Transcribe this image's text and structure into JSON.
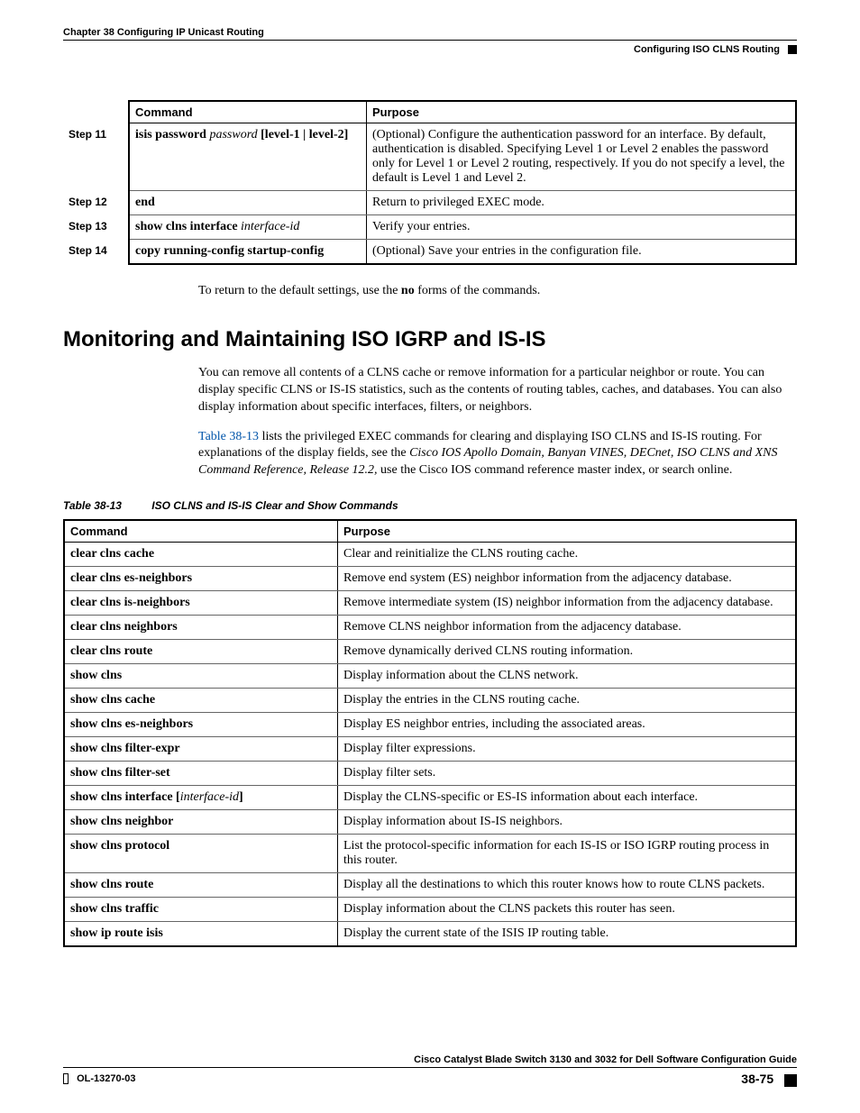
{
  "header": {
    "chapter": "Chapter 38      Configuring IP Unicast Routing",
    "section": "Configuring ISO CLNS Routing"
  },
  "steps_table": {
    "headers": {
      "command": "Command",
      "purpose": "Purpose"
    },
    "rows": [
      {
        "step": "Step 11",
        "cmd_html": "<b>isis password</b> <span class='arg'>password</span> <b>[level-1 | level-2]</b>",
        "purpose": "(Optional) Configure the authentication password for an interface. By default, authentication is disabled. Specifying Level 1 or Level 2 enables the password only for Level 1 or Level 2 routing, respectively. If you do not specify a level, the default is Level 1 and Level 2."
      },
      {
        "step": "Step 12",
        "cmd_html": "<b>end</b>",
        "purpose": "Return to privileged EXEC mode."
      },
      {
        "step": "Step 13",
        "cmd_html": "<b>show clns interface</b> <span class='arg'>interface-id</span>",
        "purpose": "Verify your entries."
      },
      {
        "step": "Step 14",
        "cmd_html": "<b>copy running-config startup-config</b>",
        "purpose": "(Optional) Save your entries in the configuration file."
      }
    ]
  },
  "return_text": "To return to the default settings, use the no forms of the commands.",
  "return_text_bold": "no",
  "heading": "Monitoring and Maintaining ISO IGRP and IS-IS",
  "para1": "You can remove all contents of a CLNS cache or remove information for a particular neighbor or route. You can display specific CLNS or IS-IS statistics, such as the contents of routing tables, caches, and databases. You can also display information about specific interfaces, filters, or neighbors.",
  "para2_link": "Table 38-13",
  "para2_a": " lists the privileged EXEC commands for clearing and displaying ISO CLNS and IS-IS routing. For explanations of the display fields, see the ",
  "para2_italic": "Cisco IOS Apollo Domain, Banyan VINES, DECnet, ISO CLNS and XNS Command Reference, Release 12.2,",
  "para2_b": " use the Cisco IOS command reference master index, or search online.",
  "table_caption_num": "Table 38-13",
  "table_caption_text": "ISO CLNS and IS-IS Clear and Show Commands",
  "cmds_table": {
    "headers": {
      "command": "Command",
      "purpose": "Purpose"
    },
    "rows": [
      {
        "cmd_html": "clear clns cache",
        "purpose": "Clear and reinitialize the CLNS routing cache."
      },
      {
        "cmd_html": "clear clns es-neighbors",
        "purpose": "Remove end system (ES) neighbor information from the adjacency database."
      },
      {
        "cmd_html": "clear clns is-neighbors",
        "purpose": "Remove intermediate system (IS) neighbor information from the adjacency database."
      },
      {
        "cmd_html": "clear clns neighbors",
        "purpose": "Remove CLNS neighbor information from the adjacency database."
      },
      {
        "cmd_html": "clear clns route",
        "purpose": "Remove dynamically derived CLNS routing information."
      },
      {
        "cmd_html": "show clns",
        "purpose": "Display information about the CLNS network."
      },
      {
        "cmd_html": "show clns cache",
        "purpose": "Display the entries in the CLNS routing cache."
      },
      {
        "cmd_html": "show clns es-neighbors",
        "purpose": "Display ES neighbor entries, including the associated areas."
      },
      {
        "cmd_html": "show clns filter-expr",
        "purpose": "Display filter expressions."
      },
      {
        "cmd_html": "show clns filter-set",
        "purpose": "Display filter sets."
      },
      {
        "cmd_html": "show clns interface [<span class='arg'>interface-id</span>]",
        "purpose": "Display the CLNS-specific or ES-IS information about each interface."
      },
      {
        "cmd_html": "show clns neighbor",
        "purpose": "Display information about IS-IS neighbors."
      },
      {
        "cmd_html": "show clns protocol",
        "purpose": "List the protocol-specific information for each IS-IS or ISO IGRP routing process in this router."
      },
      {
        "cmd_html": "show clns route",
        "purpose": "Display all the destinations to which this router knows how to route CLNS packets."
      },
      {
        "cmd_html": "show clns traffic",
        "purpose": "Display information about the CLNS packets this router has seen."
      },
      {
        "cmd_html": "show ip route isis",
        "purpose": "Display the current state of the ISIS IP routing table."
      }
    ]
  },
  "footer": {
    "title": "Cisco Catalyst Blade Switch 3130 and 3032 for Dell Software Configuration Guide",
    "doc_id": "OL-13270-03",
    "page": "38-75"
  }
}
